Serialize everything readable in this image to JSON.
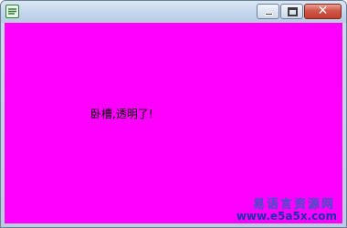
{
  "window": {
    "title": "",
    "app_icon": "app-icon",
    "buttons": {
      "minimize": "minimize",
      "maximize": "maximize",
      "close": "✕"
    }
  },
  "client": {
    "background": "#ff00ff",
    "message": "卧槽,透明了!"
  },
  "watermark": {
    "line1": "易语言资源网",
    "line2": "www.e5a5x.com"
  }
}
